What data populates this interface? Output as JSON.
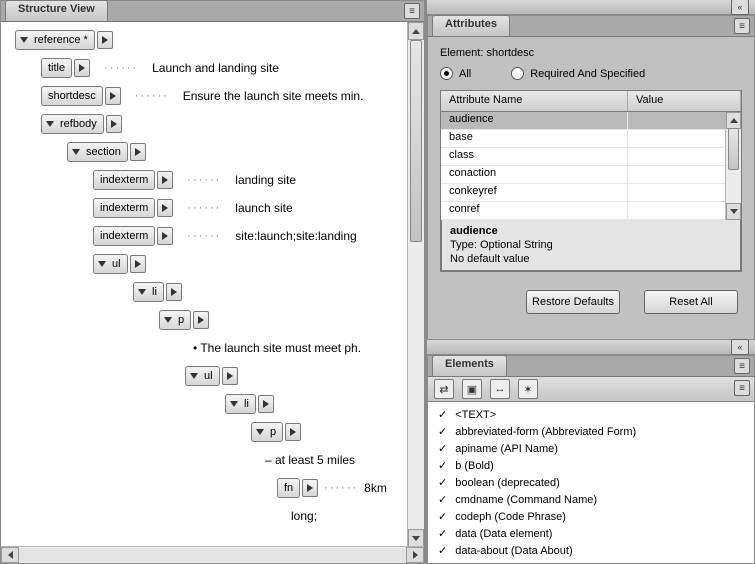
{
  "structure": {
    "tab": "Structure View",
    "tree": [
      {
        "indent": 10,
        "expand": true,
        "label": "reference *",
        "value": ""
      },
      {
        "indent": 36,
        "expand": false,
        "label": "title",
        "value": "Launch and landing site"
      },
      {
        "indent": 36,
        "expand": false,
        "label": "shortdesc",
        "value": "Ensure the launch site meets min."
      },
      {
        "indent": 36,
        "expand": true,
        "label": "refbody",
        "value": ""
      },
      {
        "indent": 62,
        "expand": true,
        "label": "section",
        "value": ""
      },
      {
        "indent": 88,
        "expand": false,
        "label": "indexterm",
        "value": "landing site"
      },
      {
        "indent": 88,
        "expand": false,
        "label": "indexterm",
        "value": "launch site"
      },
      {
        "indent": 88,
        "expand": false,
        "label": "indexterm",
        "value": "site:launch;site:landing"
      },
      {
        "indent": 88,
        "expand": true,
        "label": "ul",
        "value": ""
      },
      {
        "indent": 128,
        "expand": true,
        "label": "li",
        "value": ""
      },
      {
        "indent": 154,
        "expand": true,
        "label": "p",
        "value": ""
      },
      {
        "indent": 0,
        "text_only": true,
        "indent_text": 188,
        "value": "• The launch site must meet ph."
      },
      {
        "indent": 180,
        "expand": true,
        "label": "ul",
        "value": ""
      },
      {
        "indent": 220,
        "expand": true,
        "label": "li",
        "value": ""
      },
      {
        "indent": 246,
        "expand": true,
        "label": "p",
        "value": ""
      },
      {
        "indent": 0,
        "text_only": true,
        "indent_text": 260,
        "value": "– at least 5 miles"
      },
      {
        "indent": 272,
        "expand": false,
        "label": "fn",
        "value": "8km",
        "tight": true
      },
      {
        "indent": 0,
        "text_only": true,
        "indent_text": 286,
        "value": "long;"
      }
    ]
  },
  "attributes": {
    "tab": "Attributes",
    "elementLabel": "Element:",
    "elementName": "shortdesc",
    "radioAll": "All",
    "radioReq": "Required And Specified",
    "headers": {
      "name": "Attribute Name",
      "value": "Value"
    },
    "rows": [
      "audience",
      "base",
      "class",
      "conaction",
      "conkeyref",
      "conref"
    ],
    "info": {
      "name": "audience",
      "type": "Type: Optional String",
      "def": "No default value"
    },
    "btnRestore": "Restore Defaults",
    "btnReset": "Reset All"
  },
  "elements": {
    "tab": "Elements",
    "items": [
      {
        "n": "<TEXT>",
        "d": ""
      },
      {
        "n": "abbreviated-form",
        "d": "(Abbreviated Form)"
      },
      {
        "n": "apiname",
        "d": "(API Name)"
      },
      {
        "n": "b",
        "d": "(Bold)"
      },
      {
        "n": "boolean",
        "d": "(deprecated)"
      },
      {
        "n": "cmdname",
        "d": "(Command Name)"
      },
      {
        "n": "codeph",
        "d": "(Code Phrase)"
      },
      {
        "n": "data",
        "d": "(Data element)"
      },
      {
        "n": "data-about",
        "d": "(Data About)"
      }
    ]
  }
}
